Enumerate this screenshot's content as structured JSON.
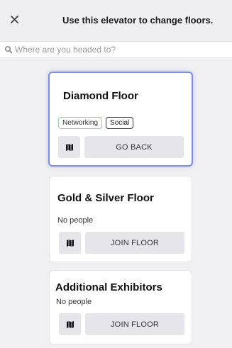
{
  "header": {
    "close_icon": "close-icon",
    "title": "Use this elevator to change floors."
  },
  "search": {
    "icon": "search-icon",
    "placeholder": "Where are you headed to?"
  },
  "floors": [
    {
      "title": "Diamond Floor",
      "tags": [
        "Networking",
        "Social"
      ],
      "people": "",
      "map_icon": "map-icon",
      "action_label": "GO BACK",
      "selected": true
    },
    {
      "title": "Gold & Silver Floor",
      "tags": [],
      "people": "No people",
      "map_icon": "map-icon",
      "action_label": "JOIN FLOOR",
      "selected": false
    },
    {
      "title": "Additional Exhibitors",
      "tags": [],
      "people": "No people",
      "map_icon": "map-icon",
      "action_label": "JOIN FLOOR",
      "selected": false
    }
  ],
  "colors": {
    "background": "#f0f0f2",
    "selected_border": "#7d8fe0",
    "networking_tag_border": "#8fd19e",
    "social_tag_border": "#1f3a5a",
    "button_bg": "#e6e6ea"
  }
}
